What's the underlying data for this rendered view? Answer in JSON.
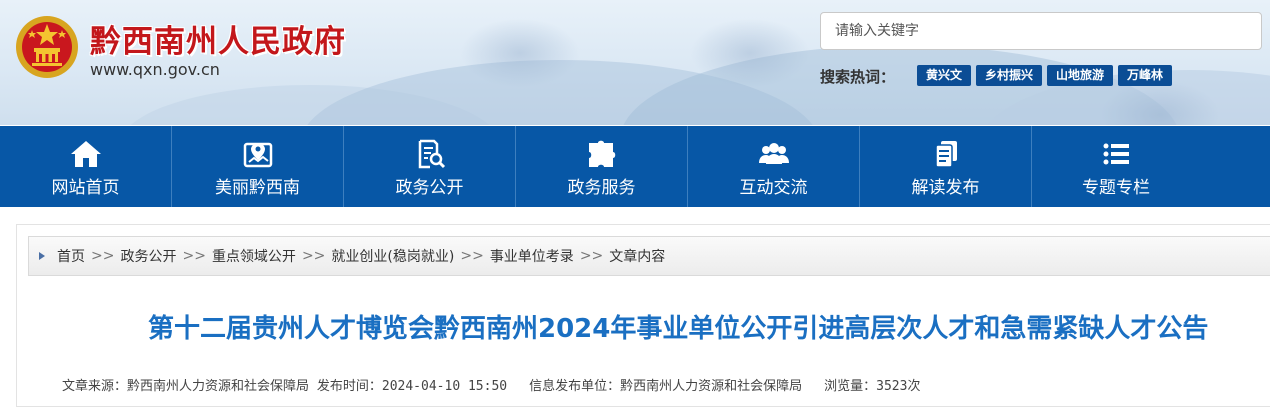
{
  "header": {
    "site_title": "黔西南州人民政府",
    "site_url": "www.qxn.gov.cn",
    "search": {
      "placeholder": "请输入关键字"
    },
    "hot_search_label": "搜索热词：",
    "hot_tags": [
      "黄兴文",
      "乡村振兴",
      "山地旅游",
      "万峰林"
    ]
  },
  "nav": {
    "items": [
      {
        "label": "网站首页",
        "icon": "home-icon"
      },
      {
        "label": "美丽黔西南",
        "icon": "map-pin-icon"
      },
      {
        "label": "政务公开",
        "icon": "document-search-icon"
      },
      {
        "label": "政务服务",
        "icon": "puzzle-icon"
      },
      {
        "label": "互动交流",
        "icon": "users-icon"
      },
      {
        "label": "解读发布",
        "icon": "documents-icon"
      },
      {
        "label": "专题专栏",
        "icon": "list-icon"
      }
    ]
  },
  "breadcrumb": {
    "items": [
      "首页",
      "政务公开",
      "重点领域公开",
      "就业创业(稳岗就业)",
      "事业单位考录",
      "文章内容"
    ],
    "separator": ">>"
  },
  "article": {
    "title": "第十二届贵州人才博览会黔西南州2024年事业单位公开引进高层次人才和急需紧缺人才公告",
    "source_label": "文章来源：",
    "source": "黔西南州人力资源和社会保障局",
    "publish_time_label": "发布时间：",
    "publish_time": "2024-04-10 15:50",
    "publisher_label": "信息发布单位：",
    "publisher": "黔西南州人力资源和社会保障局",
    "views_label": "浏览量：",
    "views": "3523次"
  },
  "colors": {
    "nav_bg": "#0757a6",
    "brand_red": "#c3171b",
    "title_blue": "#1a6fc2",
    "tag_bg": "#0b4d95"
  }
}
